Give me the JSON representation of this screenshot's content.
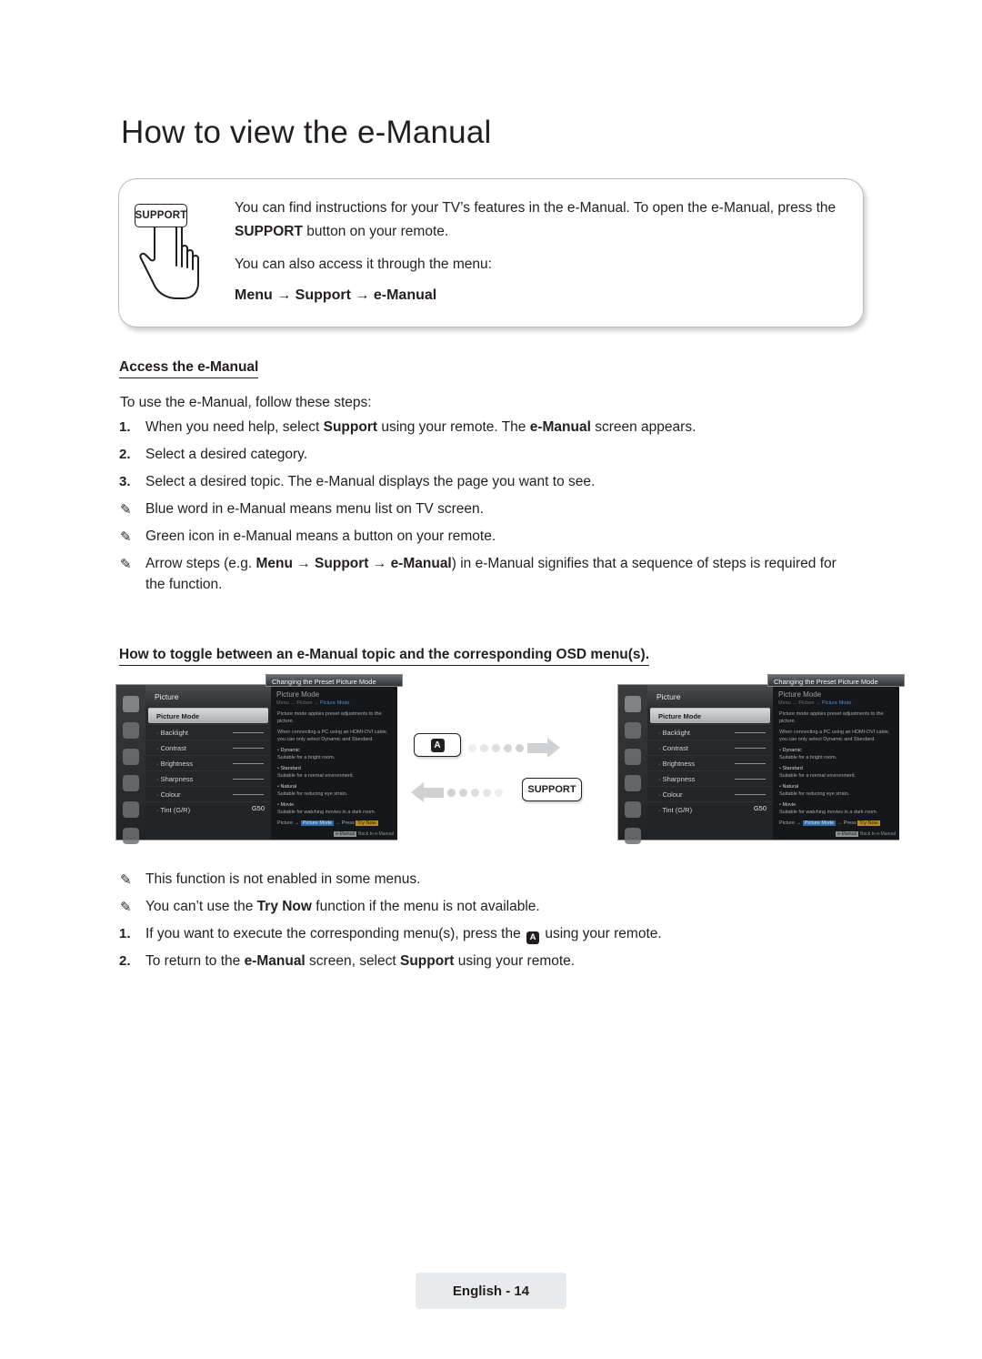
{
  "page": {
    "title": "How to view the e-Manual",
    "footer": "English - 14"
  },
  "callout": {
    "support_button_label": "SUPPORT",
    "line1_part1": "You can find instructions for your TV’s features in the e-Manual. To open the e-Manual, press the ",
    "line1_bold": "SUPPORT",
    "line1_part2": " button on your remote.",
    "line2": "You can also access it through the menu:",
    "path": "Menu → Support → e-Manual"
  },
  "access": {
    "heading": "Access the e-Manual",
    "intro": "To use the e-Manual, follow these steps:",
    "items": [
      {
        "marker": "1.",
        "type": "num",
        "html": "When you need help, select <b>Support</b> using your remote. The <b>e-Manual</b> screen appears."
      },
      {
        "marker": "2.",
        "type": "num",
        "html": "Select a desired category."
      },
      {
        "marker": "3.",
        "type": "num",
        "html": "Select a desired topic. The e-Manual displays the page you want to see."
      },
      {
        "marker": "✎",
        "type": "note",
        "html": "Blue word in e-Manual means menu list on TV screen."
      },
      {
        "marker": "✎",
        "type": "note",
        "html": "Green icon in e-Manual means a button on your remote."
      },
      {
        "marker": "✎",
        "type": "note",
        "html": "Arrow steps (e.g. <b>Menu → Support → e-Manual</b>) in e-Manual signifies that a sequence of steps is required for the function."
      }
    ]
  },
  "toggle": {
    "heading": "How to toggle between an e-Manual topic and the corresponding OSD menu(s).",
    "items": [
      {
        "marker": "✎",
        "type": "note",
        "html": "This function is not enabled in some menus."
      },
      {
        "marker": "✎",
        "type": "note",
        "html": "You can’t use the <b>Try Now</b> function if the menu is not available."
      },
      {
        "marker": "1.",
        "type": "num",
        "html": "If you want to execute the corresponding menu(s), press the <span class=\"inline-a\">A</span> using your remote."
      },
      {
        "marker": "2.",
        "type": "num",
        "html": "To return to the <b>e-Manual</b> screen, select <b>Support</b> using your remote."
      }
    ]
  },
  "figure": {
    "key_a_label": "A",
    "key_support_label": "SUPPORT",
    "osd": {
      "title": "Picture",
      "rows": [
        {
          "label": "Picture Mode",
          "value": "",
          "selected": true
        },
        {
          "label": "· Backlight",
          "value": "",
          "selected": false
        },
        {
          "label": "· Contrast",
          "value": "",
          "selected": false
        },
        {
          "label": "· Brightness",
          "value": "",
          "selected": false
        },
        {
          "label": "· Sharpness",
          "value": "",
          "selected": false
        },
        {
          "label": "· Colour",
          "value": "",
          "selected": false
        },
        {
          "label": "· Tint (G/R)",
          "value": "G50",
          "selected": false
        }
      ]
    },
    "emanual": {
      "header": "Changing the Preset Picture Mode",
      "title": "Picture Mode",
      "crumb_plain": "Menu → Picture → ",
      "crumb_blue": "Picture Mode",
      "intro": "Picture mode applies preset adjustments to the picture.",
      "note": "When connecting a PC using an HDMI-DVI cable, you can only select Dynamic and Standard.",
      "bullets": [
        {
          "name": "Dynamic",
          "desc": "Suitable for a bright room."
        },
        {
          "name": "Standard",
          "desc": "Suitable for a normal environment."
        },
        {
          "name": "Natural",
          "desc": "Suitable for reducing eye strain."
        },
        {
          "name": "Movie",
          "desc": "Suitable for watching movies in a dark room."
        }
      ],
      "try_line_pre": "Picture → ",
      "try_line_blue": "Picture Mode",
      "try_line_mid": " → Press ",
      "try_line_yellow": "Try Now",
      "footer_tag": "e-Manual",
      "footer_text": "Back to e-Manual"
    }
  }
}
